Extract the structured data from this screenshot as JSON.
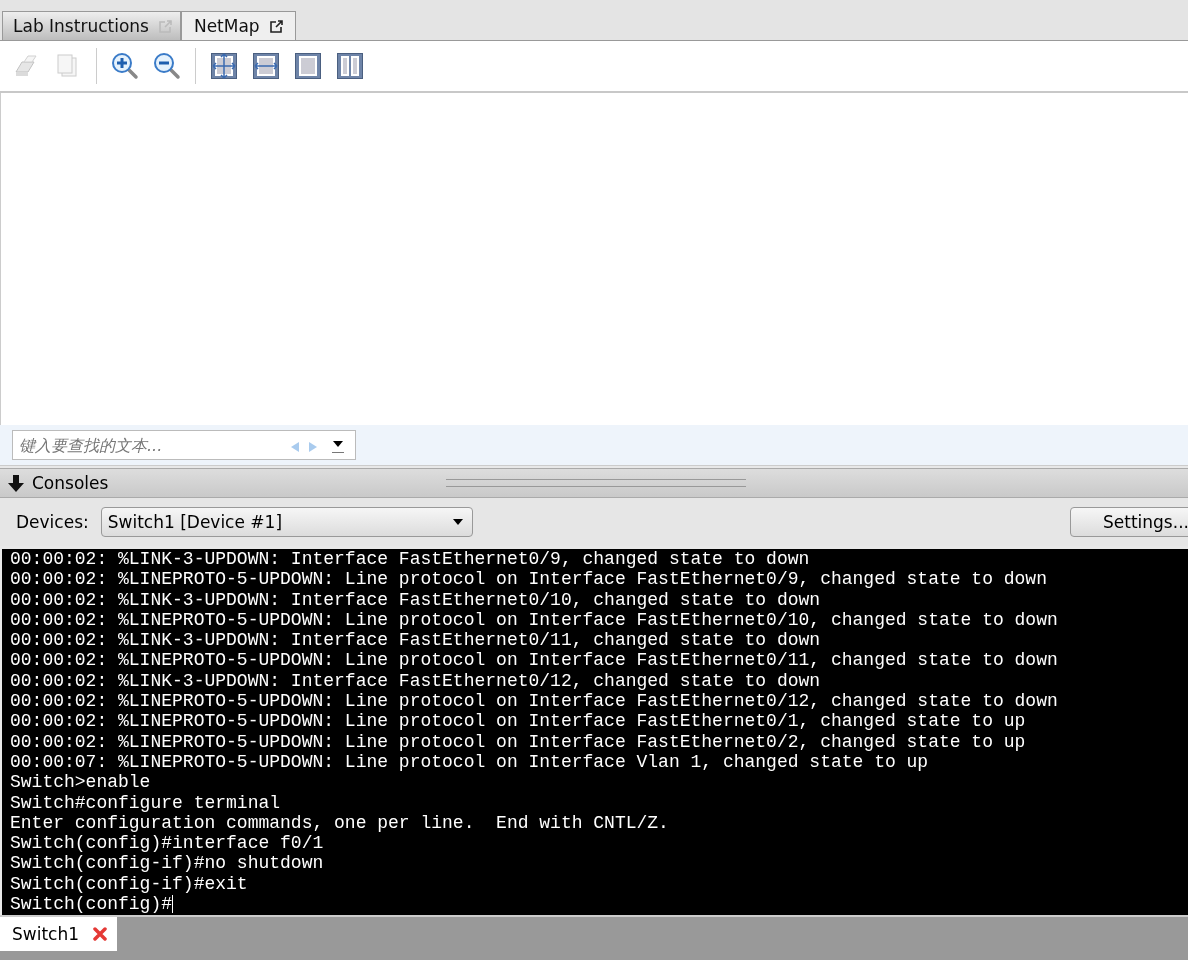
{
  "tabs": [
    {
      "label": "Lab Instructions",
      "selected": false
    },
    {
      "label": "NetMap",
      "selected": true
    }
  ],
  "toolbar": [
    {
      "kind": "print",
      "disabled": true
    },
    {
      "kind": "copy",
      "disabled": true
    },
    {
      "kind": "separator"
    },
    {
      "kind": "zoom-in",
      "disabled": false
    },
    {
      "kind": "zoom-out",
      "disabled": false
    },
    {
      "kind": "separator"
    },
    {
      "kind": "fit-page",
      "disabled": false
    },
    {
      "kind": "fit-width",
      "disabled": false
    },
    {
      "kind": "single-page",
      "disabled": false
    },
    {
      "kind": "two-page",
      "disabled": false
    }
  ],
  "find": {
    "placeholder": "键入要查找的文本..."
  },
  "consoles": {
    "title": "Consoles",
    "devices_label": "Devices:",
    "device": "Switch1 [Device #1]",
    "settings": "Settings..."
  },
  "console_lines": [
    "00:00:02: %LINK-3-UPDOWN: Interface FastEthernet0/9, changed state to down",
    "00:00:02: %LINEPROTO-5-UPDOWN: Line protocol on Interface FastEthernet0/9, changed state to down",
    "00:00:02: %LINK-3-UPDOWN: Interface FastEthernet0/10, changed state to down",
    "00:00:02: %LINEPROTO-5-UPDOWN: Line protocol on Interface FastEthernet0/10, changed state to down",
    "00:00:02: %LINK-3-UPDOWN: Interface FastEthernet0/11, changed state to down",
    "00:00:02: %LINEPROTO-5-UPDOWN: Line protocol on Interface FastEthernet0/11, changed state to down",
    "00:00:02: %LINK-3-UPDOWN: Interface FastEthernet0/12, changed state to down",
    "00:00:02: %LINEPROTO-5-UPDOWN: Line protocol on Interface FastEthernet0/12, changed state to down",
    "00:00:02: %LINEPROTO-5-UPDOWN: Line protocol on Interface FastEthernet0/1, changed state to up",
    "00:00:02: %LINEPROTO-5-UPDOWN: Line protocol on Interface FastEthernet0/2, changed state to up",
    "00:00:07: %LINEPROTO-5-UPDOWN: Line protocol on Interface Vlan 1, changed state to up",
    "Switch>enable",
    "Switch#configure terminal",
    "Enter configuration commands, one per line.  End with CNTL/Z.",
    "Switch(config)#interface f0/1",
    "Switch(config-if)#no shutdown",
    "Switch(config-if)#exit",
    "Switch(config)#"
  ],
  "bottom_tabs": [
    {
      "label": "Switch1",
      "selected": true
    }
  ]
}
